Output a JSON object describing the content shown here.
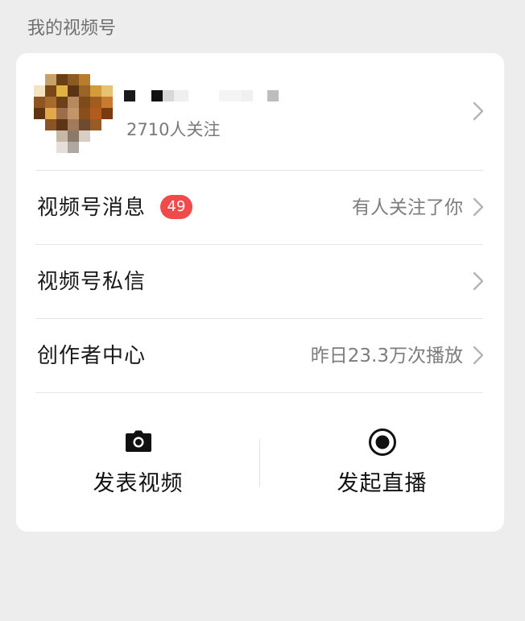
{
  "section": {
    "title": "我的视频号"
  },
  "profile": {
    "followers_text": "2710人关注",
    "avatar_icon": "pixelated-avatar",
    "name_obscured": true
  },
  "rows": [
    {
      "label": "视频号消息",
      "badge": "49",
      "value": "有人关注了你",
      "icon": "chevron-right-icon"
    },
    {
      "label": "视频号私信",
      "value": "",
      "icon": "chevron-right-icon"
    },
    {
      "label": "创作者中心",
      "value": "昨日23.3万次播放",
      "icon": "chevron-right-icon"
    }
  ],
  "actions": [
    {
      "label": "发表视频",
      "icon": "camera-icon"
    },
    {
      "label": "发起直播",
      "icon": "live-record-icon"
    }
  ],
  "colors": {
    "background": "#ededed",
    "card": "#ffffff",
    "badge": "#f04a4a",
    "text_primary": "#1a1a1a",
    "text_secondary": "#7d7d7d"
  }
}
